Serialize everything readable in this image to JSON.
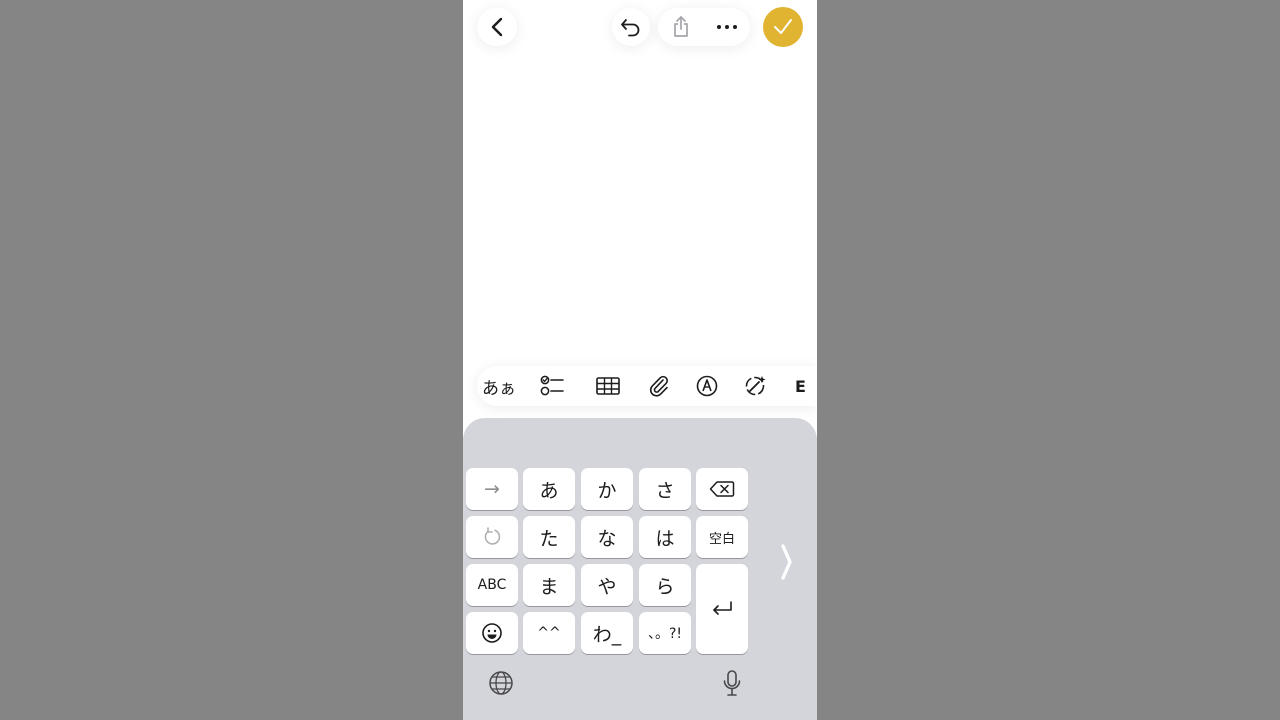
{
  "nav": {
    "back_icon": "chevron-left-icon",
    "undo_icon": "undo-icon",
    "share_icon": "share-icon",
    "more_icon": "ellipsis-icon",
    "done_icon": "checkmark-icon",
    "done_color": "#e0b330"
  },
  "toolbar": {
    "format_label": "あぁ",
    "partial_label": "E",
    "icons": [
      "checklist-icon",
      "table-icon",
      "paperclip-icon",
      "markup-icon",
      "writing-tools-icon"
    ]
  },
  "keyboard": {
    "rows": [
      [
        "→",
        "あ",
        "か",
        "さ",
        "⌫"
      ],
      [
        "↺",
        "た",
        "な",
        "は",
        "空白"
      ],
      [
        "ABC",
        "ま",
        "や",
        "ら",
        "⏎"
      ],
      [
        "☺",
        "^^",
        "わ_",
        "、。?!"
      ]
    ],
    "keys": {
      "next": "→",
      "a": "あ",
      "ka": "か",
      "sa": "さ",
      "ta": "た",
      "na": "な",
      "ha": "は",
      "space": "空白",
      "abc": "ABC",
      "ma": "ま",
      "ya": "や",
      "ra": "ら",
      "emoticon": "^^",
      "wa": "わ_",
      "punct": "、。?!"
    },
    "bg_color": "#d3d5db"
  }
}
